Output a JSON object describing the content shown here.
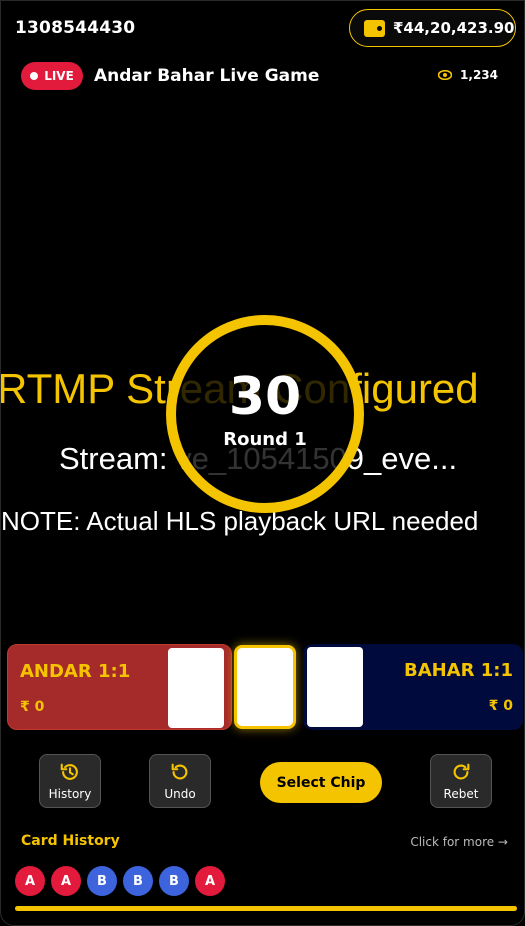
{
  "header": {
    "user_id": "1308544430",
    "wallet_balance": "₹44,20,423.90"
  },
  "live": {
    "badge": "LIVE",
    "title": "Andar Bahar Live Game",
    "viewers": "1,234"
  },
  "stream": {
    "line1": "RTMP Stream Configured",
    "line2": "Stream: ve_10541509_eve...",
    "line3": "NOTE: Actual HLS playback URL needed"
  },
  "timer": {
    "seconds": "30",
    "round": "Round 1"
  },
  "andar": {
    "label": "ANDAR 1:1",
    "amount": "₹ 0"
  },
  "bahar": {
    "label": "BAHAR 1:1",
    "amount": "₹ 0"
  },
  "controls": {
    "history": "History",
    "undo": "Undo",
    "select_chip": "Select Chip",
    "rebet": "Rebet"
  },
  "card_history": {
    "title": "Card History",
    "more": "Click for more →",
    "items": [
      "A",
      "A",
      "B",
      "B",
      "B",
      "A"
    ]
  },
  "progress": {
    "fraction": 1.0
  },
  "colors": {
    "accent": "#f5c400",
    "live": "#e21b3c",
    "andar": "#a52a2a",
    "bahar": "#000a3c",
    "history_a": "#e21b3c",
    "history_b": "#3d63dd"
  }
}
